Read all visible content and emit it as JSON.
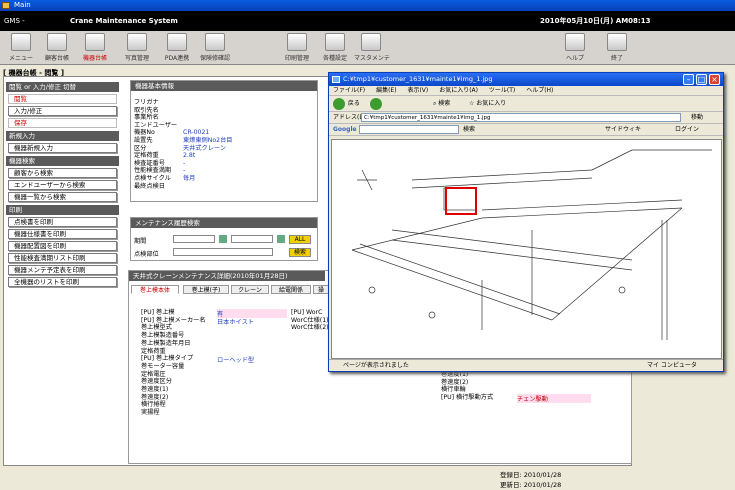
{
  "window": {
    "title": "Main"
  },
  "app": {
    "name": "GMS -",
    "system_name": "Crane Maintenance System",
    "datetime": "2010年05月10日(月) AM08:13"
  },
  "toolbar": {
    "items": [
      {
        "label": "メニュー"
      },
      {
        "label": "顧客台帳"
      },
      {
        "label": "機器台帳"
      },
      {
        "label": "写真管理"
      },
      {
        "label": "PDA連携"
      },
      {
        "label": "保険修確認"
      },
      {
        "label": "印刷管理"
      },
      {
        "label": "各種設定"
      },
      {
        "label": "マスタメンテ"
      },
      {
        "label": "ヘルプ"
      },
      {
        "label": "終了"
      }
    ]
  },
  "breadcrumb": "[ 機器台帳 - 閲覧 ]",
  "left": {
    "sec1": "閲覧 or 入力/修正 切替",
    "view": "閲覧",
    "input": "入力/修正",
    "save": "保存",
    "sec2": "新規入力",
    "new_machine": "機器新規入力",
    "sec3": "機器検索",
    "search_customer": "顧客から検索",
    "search_enduser": "エンドユーザーから検索",
    "search_list": "機器一覧から検索",
    "sec4": "印刷",
    "print_inspection": "点検書を印刷",
    "print_ledger": "機器仕様書を印刷",
    "print_layout": "機器配置図を印刷",
    "print_perf": "性能検査満期リスト印刷",
    "print_maint": "機器メンテ予定表を印刷",
    "print_all": "全機器のリストを印刷"
  },
  "basic": {
    "header": "機器基本情報",
    "labels": [
      "フリガナ",
      "取引先名",
      "事業所名",
      "エンドユーザー",
      "機器No",
      "設置先",
      "区分",
      "定格荷重",
      "検査証番号",
      "性能検査満期",
      "点検サイクル",
      "最終点検日"
    ],
    "values": [
      "",
      "",
      "",
      "",
      "CR-0021",
      "東燎東側No2台目",
      "天井式クレーン",
      "2.8t",
      "-",
      "-",
      "毎月",
      ""
    ]
  },
  "history": {
    "header": "メンテナンス履歴検索",
    "period": "期間",
    "part": "点検部位",
    "all": "ALL",
    "search": "検索"
  },
  "detail": {
    "header": "天井式クレーンメンテナンス詳細(2010年01月28日)",
    "tabs": [
      "巻上模本体",
      "巻上模(子)",
      "クレーン",
      "給電関係",
      "操"
    ],
    "labels": [
      "[PU] 巻上模",
      "[PU] 巻上模メーカー名",
      "巻上模型式",
      "巻上模製造番号",
      "巻上模製造年月日",
      "定格荷重",
      "[PU] 巻上模タイプ",
      "巻モーター容量",
      "定格電圧",
      "巻速度区分",
      "巻速度(1)",
      "巻速度(2)",
      "横行捲程",
      "実揚程"
    ],
    "values": [
      "有",
      "日本ホイスト",
      "",
      "",
      "",
      "",
      "ローヘッド型",
      "",
      "",
      "",
      "",
      "",
      "",
      ""
    ],
    "mid_labels": [
      "[PU] WorC",
      "WorC仕様(1)",
      "WorC仕様(2)"
    ],
    "right_labels": [
      "巻速度(1)",
      "巻速度(2)",
      "横行車輪",
      "[PU] 横行駆動方式"
    ],
    "right_values": [
      "",
      "",
      "",
      "チェン駆動"
    ]
  },
  "footer": {
    "reg_label": "登録日:",
    "reg_date": "2010/01/28",
    "upd_label": "更新日:",
    "upd_date": "2010/01/28"
  },
  "ie": {
    "title": "C:¥tmp1¥customer_1631¥mainte1¥img_1.jpg",
    "menu": [
      "ファイル(F)",
      "編集(E)",
      "表示(V)",
      "お気に入り(A)",
      "ツール(T)",
      "ヘルプ(H)"
    ],
    "back": "戻る",
    "search": "検索",
    "favorites": "お気に入り",
    "address_label": "アドレス(D)",
    "address": "C:¥tmp1¥customer_1631¥mainte1¥img_1.jpg",
    "go": "移動",
    "google": "Google",
    "search2": "検索",
    "sidewiki": "サイドウィキ",
    "login": "ログイン",
    "status": "ページが表示されました",
    "zone": "マイ コンピュータ"
  }
}
